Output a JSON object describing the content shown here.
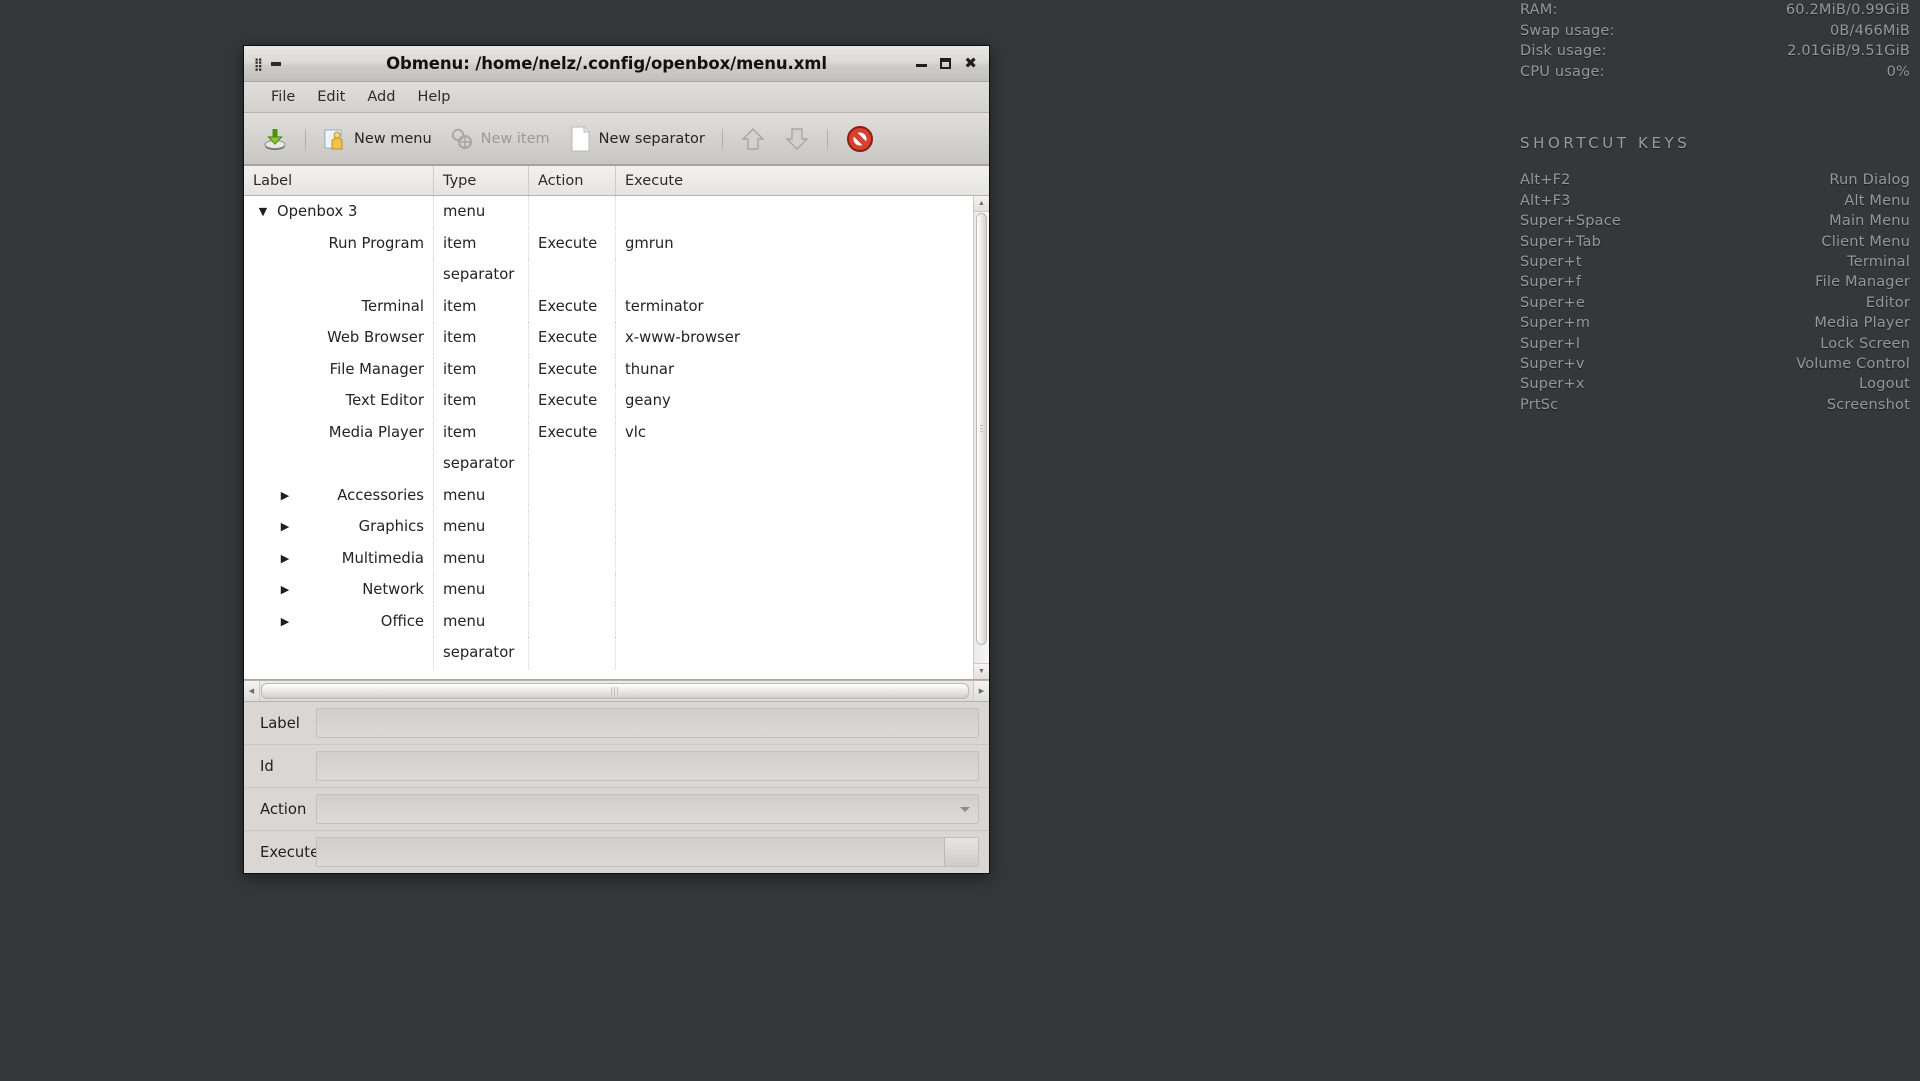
{
  "window": {
    "title": "Obmenu: /home/nelz/.config/openbox/menu.xml",
    "titlebar_icons": {
      "menu": "window-menu-icon",
      "shade": "window-shade-icon",
      "minimize": "minimize-icon",
      "maximize": "maximize-icon",
      "close": "close-icon"
    }
  },
  "menubar": {
    "items": [
      {
        "label": "File"
      },
      {
        "label": "Edit"
      },
      {
        "label": "Add"
      },
      {
        "label": "Help"
      }
    ]
  },
  "toolbar": {
    "save_label": "",
    "buttons": [
      {
        "label": "New menu",
        "icon": "new-menu-icon",
        "disabled": false
      },
      {
        "label": "New item",
        "icon": "new-item-icon",
        "disabled": true
      },
      {
        "label": "New separator",
        "icon": "new-separator-icon",
        "disabled": false
      }
    ],
    "move_up_label": "",
    "move_down_label": "",
    "delete_label": ""
  },
  "tree": {
    "columns": [
      "Label",
      "Type",
      "Action",
      "Execute"
    ],
    "rows": [
      {
        "indent": 0,
        "twisty": "expanded",
        "label": "Openbox 3",
        "type": "menu",
        "action": "",
        "execute": ""
      },
      {
        "indent": 1,
        "twisty": "none",
        "label": "Run Program",
        "type": "item",
        "action": "Execute",
        "execute": "gmrun"
      },
      {
        "indent": 1,
        "twisty": "none",
        "label": "",
        "type": "separator",
        "action": "",
        "execute": ""
      },
      {
        "indent": 1,
        "twisty": "none",
        "label": "Terminal",
        "type": "item",
        "action": "Execute",
        "execute": "terminator"
      },
      {
        "indent": 1,
        "twisty": "none",
        "label": "Web Browser",
        "type": "item",
        "action": "Execute",
        "execute": "x-www-browser"
      },
      {
        "indent": 1,
        "twisty": "none",
        "label": "File Manager",
        "type": "item",
        "action": "Execute",
        "execute": "thunar"
      },
      {
        "indent": 1,
        "twisty": "none",
        "label": "Text Editor",
        "type": "item",
        "action": "Execute",
        "execute": "geany"
      },
      {
        "indent": 1,
        "twisty": "none",
        "label": "Media Player",
        "type": "item",
        "action": "Execute",
        "execute": "vlc"
      },
      {
        "indent": 1,
        "twisty": "none",
        "label": "",
        "type": "separator",
        "action": "",
        "execute": ""
      },
      {
        "indent": 1,
        "twisty": "collapsed",
        "label": "Accessories",
        "type": "menu",
        "action": "",
        "execute": ""
      },
      {
        "indent": 1,
        "twisty": "collapsed",
        "label": "Graphics",
        "type": "menu",
        "action": "",
        "execute": ""
      },
      {
        "indent": 1,
        "twisty": "collapsed",
        "label": "Multimedia",
        "type": "menu",
        "action": "",
        "execute": ""
      },
      {
        "indent": 1,
        "twisty": "collapsed",
        "label": "Network",
        "type": "menu",
        "action": "",
        "execute": ""
      },
      {
        "indent": 1,
        "twisty": "collapsed",
        "label": "Office",
        "type": "menu",
        "action": "",
        "execute": ""
      },
      {
        "indent": 1,
        "twisty": "none",
        "label": "",
        "type": "separator",
        "action": "",
        "execute": ""
      }
    ]
  },
  "form": {
    "fields": [
      {
        "label": "Label",
        "value": "",
        "kind": "text"
      },
      {
        "label": "Id",
        "value": "",
        "kind": "text"
      },
      {
        "label": "Action",
        "value": "",
        "kind": "combo"
      },
      {
        "label": "Execute",
        "value": "",
        "kind": "text-browse"
      }
    ]
  },
  "conky": {
    "system": [
      {
        "key": "RAM:",
        "value": "60.2MiB/0.99GiB"
      },
      {
        "key": "Swap usage:",
        "value": "0B/466MiB"
      },
      {
        "key": "Disk usage:",
        "value": "2.01GiB/9.51GiB"
      },
      {
        "key": "CPU usage:",
        "value": "0%"
      }
    ],
    "shortcut_title": "SHORTCUT KEYS",
    "shortcuts": [
      {
        "key": "Alt+F2",
        "value": "Run Dialog"
      },
      {
        "key": "Alt+F3",
        "value": "Alt Menu"
      },
      {
        "key": "Super+Space",
        "value": "Main Menu"
      },
      {
        "key": "Super+Tab",
        "value": "Client Menu"
      },
      {
        "key": "Super+t",
        "value": "Terminal"
      },
      {
        "key": "Super+f",
        "value": "File Manager"
      },
      {
        "key": "Super+e",
        "value": "Editor"
      },
      {
        "key": "Super+m",
        "value": "Media Player"
      },
      {
        "key": "Super+l",
        "value": "Lock Screen"
      },
      {
        "key": "Super+v",
        "value": "Volume Control"
      },
      {
        "key": "Super+x",
        "value": "Logout"
      },
      {
        "key": "PrtSc",
        "value": "Screenshot"
      }
    ]
  },
  "colors": {
    "desktop_bg": "#34383b",
    "window_bg": "#d6d3d0",
    "tree_bg": "#ffffff",
    "conky_text": "#9aa0a4",
    "delete_red": "#c0392b",
    "save_green": "#8cc63e"
  }
}
